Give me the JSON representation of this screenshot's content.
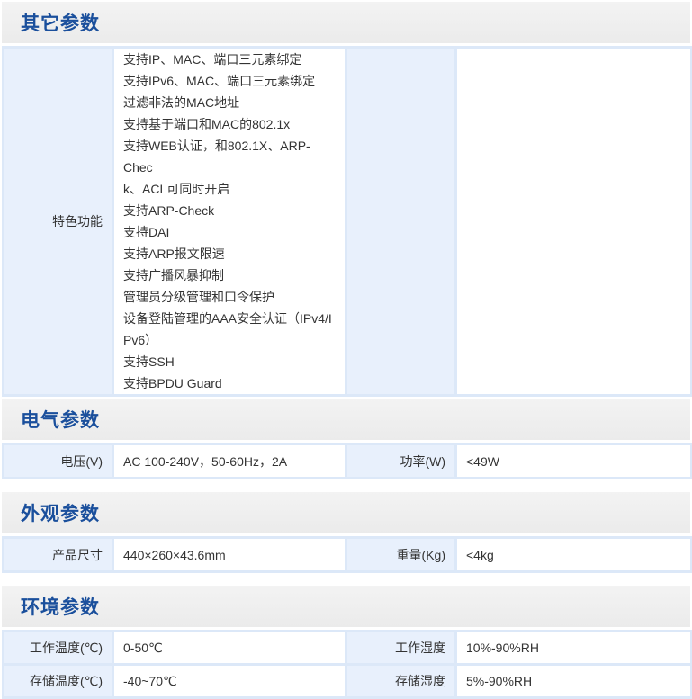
{
  "sections": [
    {
      "title": "其它参数",
      "rows": [
        {
          "label_left": "特色功能",
          "value_lines": [
            "支持IP、MAC、端口三元素绑定",
            "支持IPv6、MAC、端口三元素绑定",
            "过滤非法的MAC地址",
            "支持基于端口和MAC的802.1x",
            "支持WEB认证，和802.1X、ARP-Chec",
            "k、ACL可同时开启",
            "支持ARP-Check",
            "支持DAI",
            "支持ARP报文限速",
            "支持广播风暴抑制",
            "管理员分级管理和口令保护",
            "设备登陆管理的AAA安全认证（IPv4/I",
            "Pv6）",
            "支持SSH",
            "支持BPDU Guard"
          ],
          "label_right": "",
          "value_right": ""
        }
      ]
    },
    {
      "title": "电气参数",
      "rows": [
        {
          "label_left": "电压(V)",
          "value_left": "AC 100-240V，50-60Hz，2A",
          "label_right": "功率(W)",
          "value_right": "<49W"
        }
      ]
    },
    {
      "title": "外观参数",
      "rows": [
        {
          "label_left": "产品尺寸",
          "value_left": "440×260×43.6mm",
          "label_right": "重量(Kg)",
          "value_right": "<4kg"
        }
      ]
    },
    {
      "title": "环境参数",
      "rows": [
        {
          "label_left": "工作温度(℃)",
          "value_left": "0-50℃",
          "label_right": "工作湿度",
          "value_right": "10%-90%RH"
        },
        {
          "label_left": "存储温度(℃)",
          "value_left": "-40~70℃",
          "label_right": "存储湿度",
          "value_right": "5%-90%RH"
        }
      ]
    }
  ]
}
